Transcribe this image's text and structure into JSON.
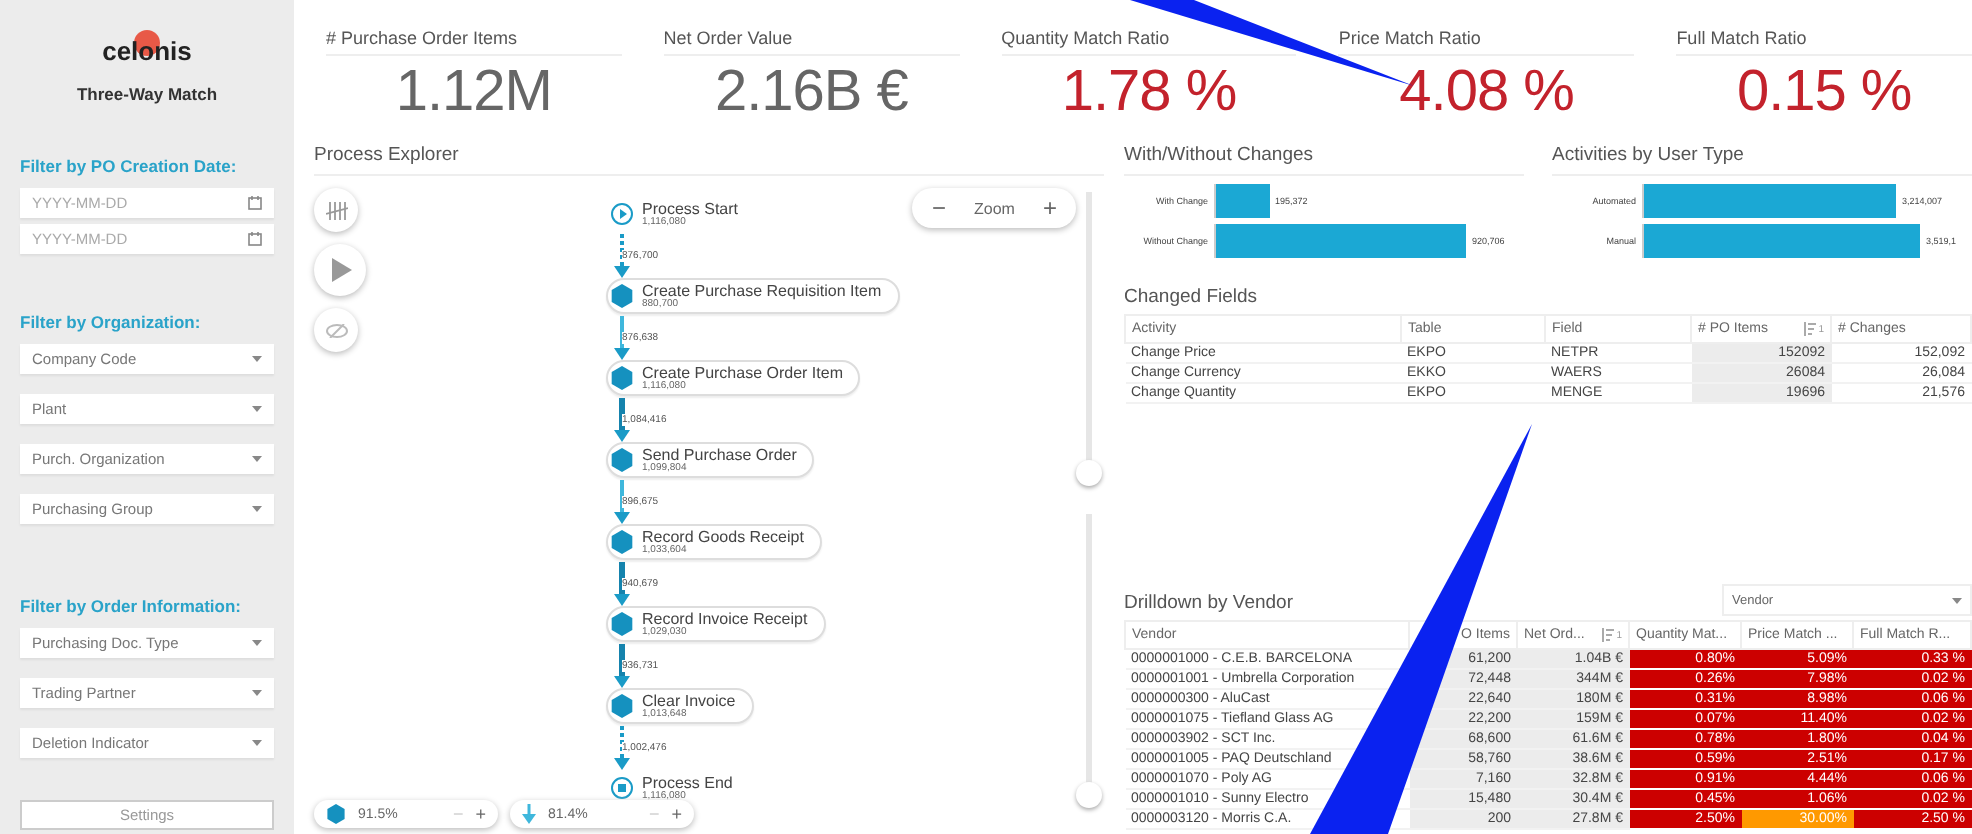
{
  "sidebar": {
    "logo": "celonis",
    "subtitle": "Three-Way Match",
    "sections": [
      {
        "heading": "Filter by PO Creation Date:",
        "fields": [
          {
            "kind": "date",
            "placeholder": "YYYY-MM-DD"
          },
          {
            "kind": "date",
            "placeholder": "YYYY-MM-DD"
          }
        ]
      },
      {
        "heading": "Filter by Organization:",
        "fields": [
          {
            "kind": "dropdown",
            "placeholder": "Company Code"
          },
          {
            "kind": "dropdown",
            "placeholder": "Plant"
          },
          {
            "kind": "dropdown",
            "placeholder": "Purch. Organization"
          },
          {
            "kind": "dropdown",
            "placeholder": "Purchasing Group"
          }
        ]
      },
      {
        "heading": "Filter by Order Information:",
        "fields": [
          {
            "kind": "dropdown",
            "placeholder": "Purchasing Doc. Type"
          },
          {
            "kind": "dropdown",
            "placeholder": "Trading Partner"
          },
          {
            "kind": "dropdown",
            "placeholder": "Deletion Indicator"
          }
        ]
      }
    ],
    "settings_button": "Settings"
  },
  "kpis": [
    {
      "label": "# Purchase Order Items",
      "value": "1.12M",
      "alert": false
    },
    {
      "label": "Net Order Value",
      "value": "2.16B €",
      "alert": false
    },
    {
      "label": "Quantity Match Ratio",
      "value": "1.78 %",
      "alert": true
    },
    {
      "label": "Price Match Ratio",
      "value": "4.08 %",
      "alert": true
    },
    {
      "label": "Full Match Ratio",
      "value": "0.15 %",
      "alert": true
    }
  ],
  "process_explorer": {
    "title": "Process Explorer",
    "zoom_label": "Zoom",
    "zoom_minus": "−",
    "zoom_plus": "+",
    "nodes": [
      {
        "kind": "start",
        "label": "Process Start",
        "count": "1,116,080"
      },
      {
        "kind": "activity",
        "label": "Create Purchase Requisition Item",
        "count": "880,700"
      },
      {
        "kind": "activity",
        "label": "Create Purchase Order Item",
        "count": "1,116,080"
      },
      {
        "kind": "activity",
        "label": "Send Purchase Order",
        "count": "1,099,804"
      },
      {
        "kind": "activity",
        "label": "Record Goods Receipt",
        "count": "1,033,604"
      },
      {
        "kind": "activity",
        "label": "Record Invoice Receipt",
        "count": "1,029,030"
      },
      {
        "kind": "activity",
        "label": "Clear Invoice",
        "count": "1,013,648"
      },
      {
        "kind": "end",
        "label": "Process End",
        "count": "1,116,080"
      }
    ],
    "edges": [
      {
        "kind": "dashed",
        "count": "876,700"
      },
      {
        "kind": "solid",
        "count": "876,638"
      },
      {
        "kind": "thick",
        "count": "1,084,416"
      },
      {
        "kind": "solid",
        "count": "896,675"
      },
      {
        "kind": "thick",
        "count": "940,679"
      },
      {
        "kind": "thick",
        "count": "936,731"
      },
      {
        "kind": "dashed",
        "count": "1,002,476"
      }
    ],
    "activity_stepper": {
      "value": "91.5%",
      "minus": "−",
      "plus": "+"
    },
    "connection_stepper": {
      "value": "81.4%",
      "minus": "−",
      "plus": "+"
    },
    "vertical_sliders": [
      {
        "level": 0
      },
      {
        "level": 0
      }
    ]
  },
  "with_without_changes": {
    "title": "With/Without Changes",
    "chart_data": {
      "type": "bar",
      "orientation": "horizontal",
      "categories": [
        "With Change",
        "Without Change"
      ],
      "values": [
        195372,
        920706
      ],
      "data_labels": true,
      "value_labels": [
        "195,372",
        "920,706"
      ]
    }
  },
  "activities_by_user_type": {
    "title": "Activities by User Type",
    "chart_data": {
      "type": "bar",
      "orientation": "horizontal",
      "categories": [
        "Automated",
        "Manual"
      ],
      "values": [
        3214007,
        3519100
      ],
      "data_labels": true,
      "value_labels": [
        "3,214,007",
        "3,519,1"
      ]
    }
  },
  "changed_fields": {
    "title": "Changed Fields",
    "columns": [
      {
        "label": "Activity"
      },
      {
        "label": "Table"
      },
      {
        "label": "Field"
      },
      {
        "label": "# PO Items",
        "sort": "1"
      },
      {
        "label": "# Changes"
      }
    ],
    "rows": [
      [
        "Change Price",
        "EKPO",
        "NETPR",
        "152092",
        "152,092"
      ],
      [
        "Change Currency",
        "EKKO",
        "WAERS",
        "26084",
        "26,084"
      ],
      [
        "Change Quantity",
        "EKPO",
        "MENGE",
        "19696",
        "21,576"
      ]
    ]
  },
  "drilldown": {
    "title": "Drilldown by Vendor",
    "dropdown": "Vendor",
    "columns": [
      {
        "label": "Vendor"
      },
      {
        "label": "O Items"
      },
      {
        "label": "Net Ord...",
        "sort": "1"
      },
      {
        "label": "Quantity Mat..."
      },
      {
        "label": "Price Match ..."
      },
      {
        "label": "Full Match R..."
      }
    ],
    "rows": [
      {
        "vendor": "0000001000 - C.E.B. BARCELONA",
        "po_items": "61,200",
        "net": "1.04B €",
        "ratios": [
          {
            "text": "0.80%",
            "color": "#cc0000"
          },
          {
            "text": "5.09%",
            "color": "#cc0000"
          },
          {
            "text": "0.33 %",
            "color": "#cc0000"
          }
        ]
      },
      {
        "vendor": "0000001001 - Umbrella Corporation",
        "po_items": "72,448",
        "net": "344M €",
        "ratios": [
          {
            "text": "0.26%",
            "color": "#cc0000"
          },
          {
            "text": "7.98%",
            "color": "#cc0000"
          },
          {
            "text": "0.02 %",
            "color": "#cc0000"
          }
        ]
      },
      {
        "vendor": "0000000300 - AluCast",
        "po_items": "22,640",
        "net": "180M €",
        "ratios": [
          {
            "text": "0.31%",
            "color": "#cc0000"
          },
          {
            "text": "8.98%",
            "color": "#cc0000"
          },
          {
            "text": "0.06 %",
            "color": "#cc0000"
          }
        ]
      },
      {
        "vendor": "0000001075 - Tiefland Glass AG",
        "po_items": "22,200",
        "net": "159M €",
        "ratios": [
          {
            "text": "0.07%",
            "color": "#cc0000"
          },
          {
            "text": "11.40%",
            "color": "#cc0000"
          },
          {
            "text": "0.02 %",
            "color": "#cc0000"
          }
        ]
      },
      {
        "vendor": "0000003902 - SCT Inc.",
        "po_items": "68,600",
        "net": "61.6M €",
        "ratios": [
          {
            "text": "0.78%",
            "color": "#cc0000"
          },
          {
            "text": "1.80%",
            "color": "#cc0000"
          },
          {
            "text": "0.04 %",
            "color": "#cc0000"
          }
        ]
      },
      {
        "vendor": "0000001005 - PAQ Deutschland",
        "po_items": "58,760",
        "net": "38.6M €",
        "ratios": [
          {
            "text": "0.59%",
            "color": "#cc0000"
          },
          {
            "text": "2.51%",
            "color": "#cc0000"
          },
          {
            "text": "0.17 %",
            "color": "#cc0000"
          }
        ]
      },
      {
        "vendor": "0000001070 - Poly AG",
        "po_items": "7,160",
        "net": "32.8M €",
        "ratios": [
          {
            "text": "0.91%",
            "color": "#cc0000"
          },
          {
            "text": "4.44%",
            "color": "#cc0000"
          },
          {
            "text": "0.06 %",
            "color": "#cc0000"
          }
        ]
      },
      {
        "vendor": "0000001010 - Sunny Electro",
        "po_items": "15,480",
        "net": "30.4M €",
        "ratios": [
          {
            "text": "0.45%",
            "color": "#cc0000"
          },
          {
            "text": "1.06%",
            "color": "#cc0000"
          },
          {
            "text": "0.02 %",
            "color": "#cc0000"
          }
        ]
      },
      {
        "vendor": "0000003120 - Morris C.A.",
        "po_items": "200",
        "net": "27.8M €",
        "ratios": [
          {
            "text": "2.50%",
            "color": "#cc0000"
          },
          {
            "text": "30.00%",
            "color": "#ff9900"
          },
          {
            "text": "2.50 %",
            "color": "#cc0000"
          }
        ]
      }
    ]
  },
  "annotation_arrows": [
    {
      "kind": "arrow"
    },
    {
      "kind": "arrow"
    }
  ]
}
